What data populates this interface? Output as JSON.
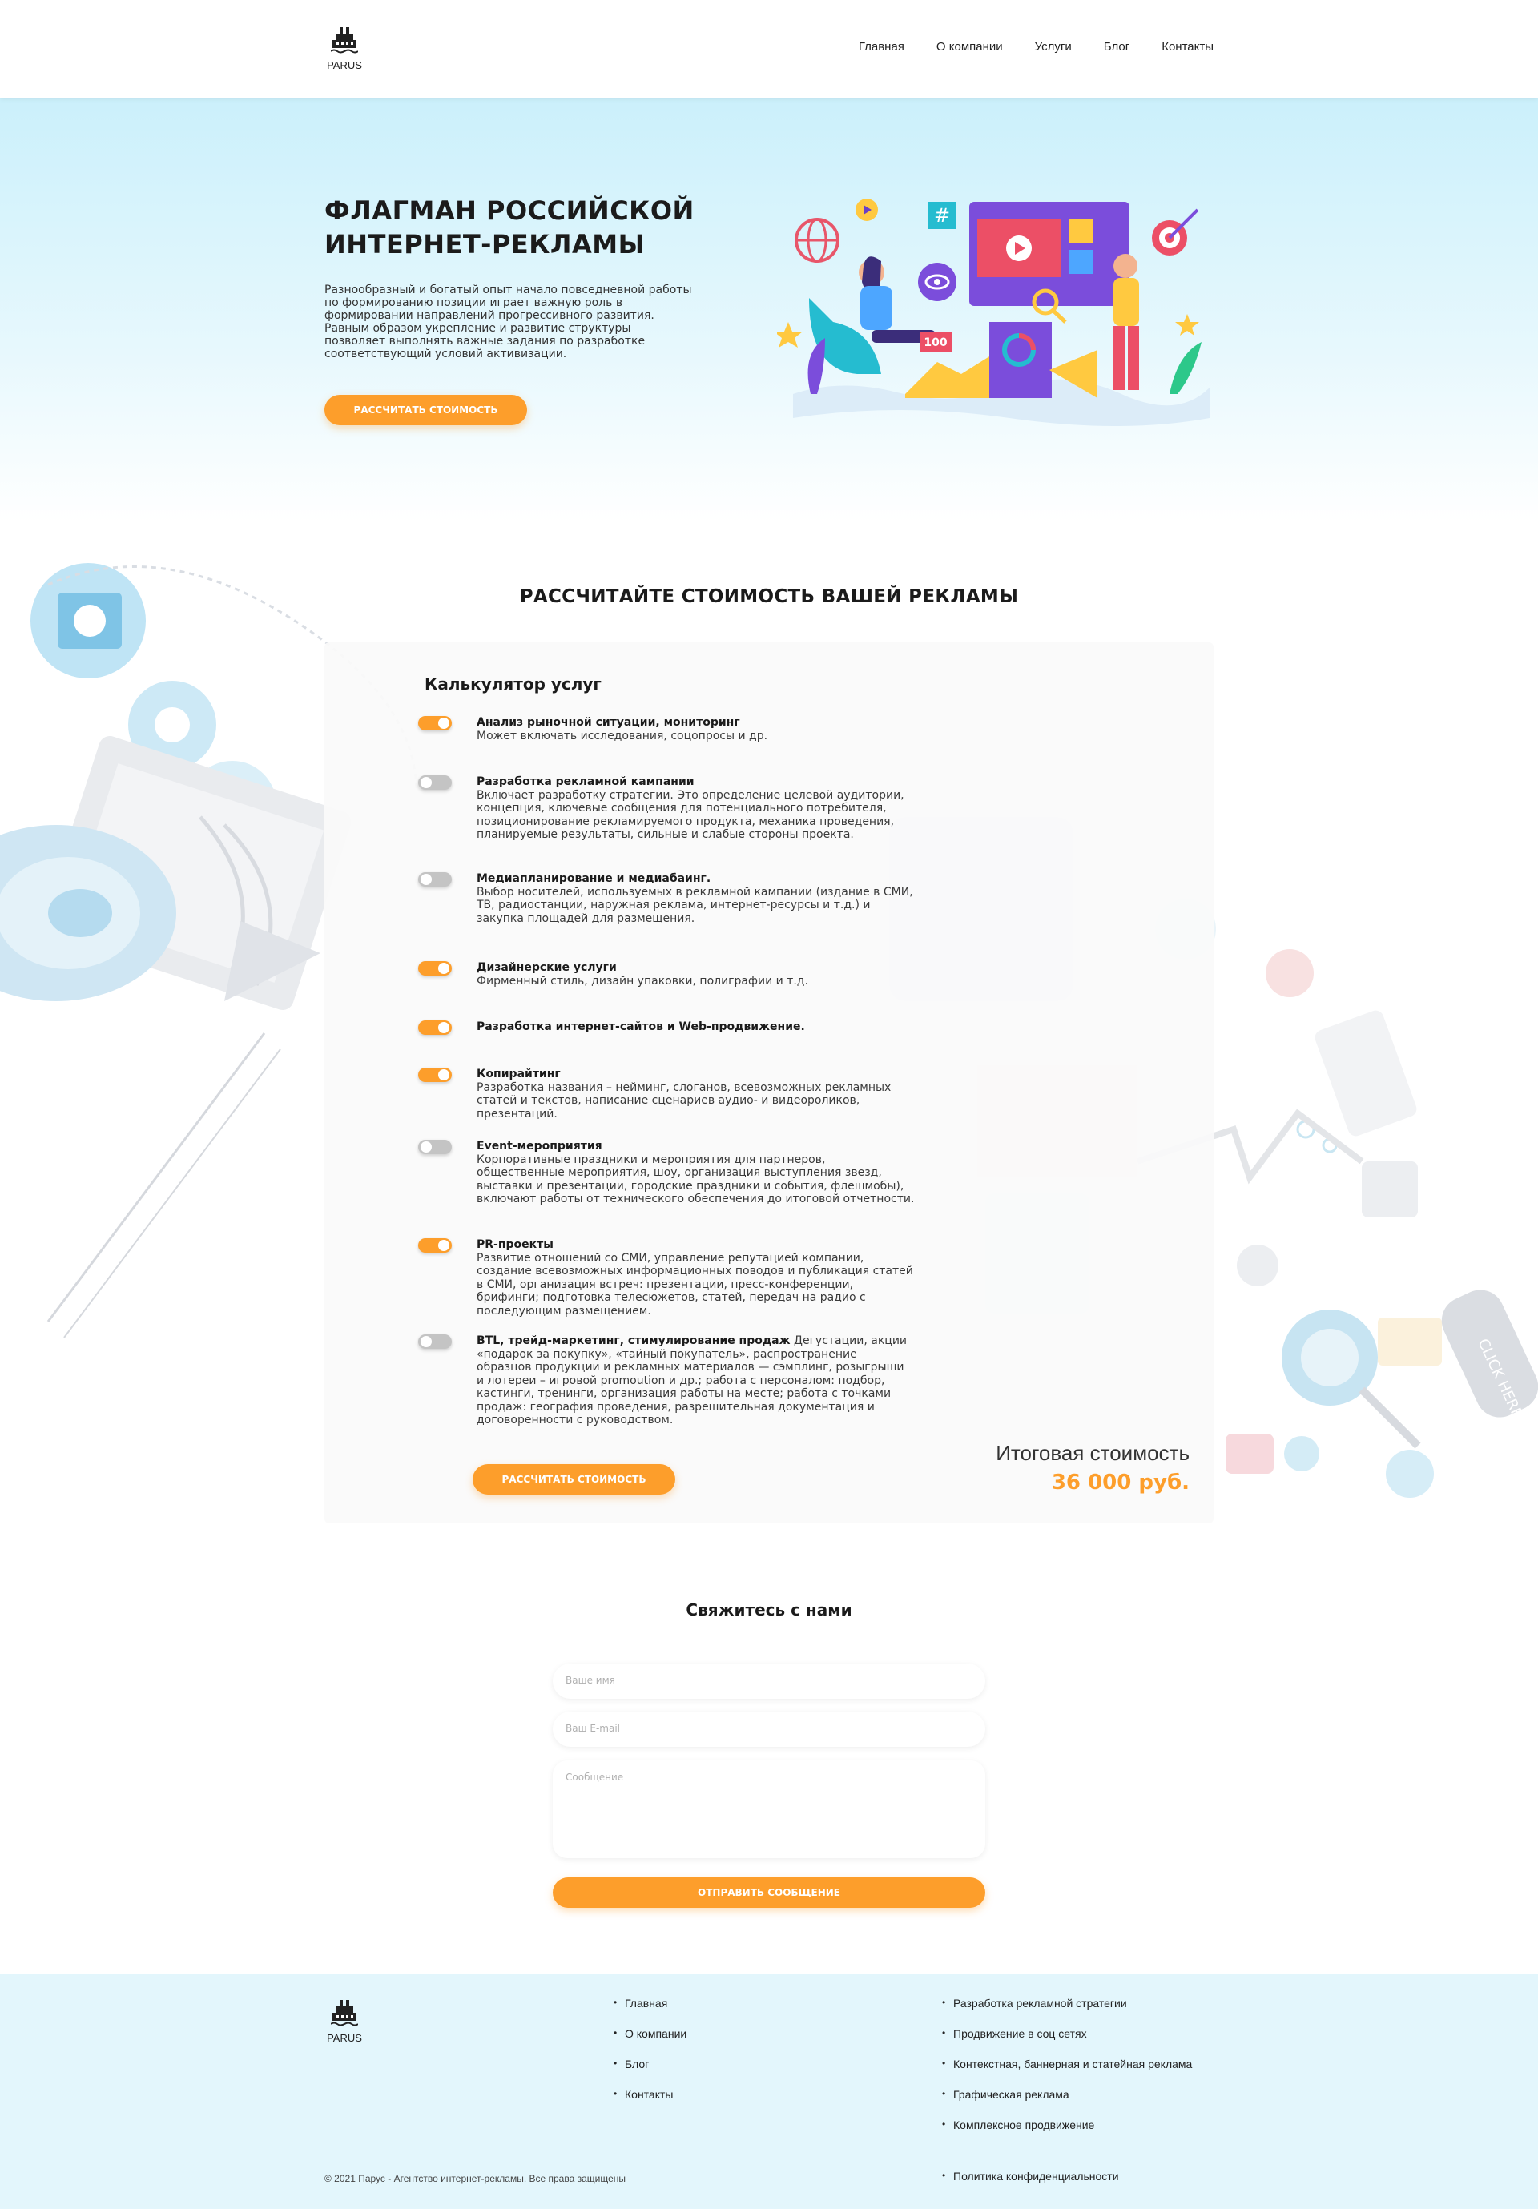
{
  "header": {
    "logo_text": "PARUS",
    "nav": [
      {
        "label": "Главная"
      },
      {
        "label": "О компании"
      },
      {
        "label": "Услуги"
      },
      {
        "label": "Блог"
      },
      {
        "label": "Контакты"
      }
    ]
  },
  "hero": {
    "title_line1": "ФЛАГМАН РОССИЙСКОЙ",
    "title_line2": "ИНТЕРНЕТ-РЕКЛАМЫ",
    "lead": "Разнообразный и богатый опыт начало повседневной работы по формированию позиции играет важную роль в формировании направлений прогрессивного развития. Равным образом укрепление и развитие структуры позволяет выполнять важные задания по разработке соответствующий условий активизации.",
    "button": "РАССЧИТАТЬ СТОИМОСТЬ",
    "art_badge": "100",
    "art_hash": "#"
  },
  "calculator": {
    "section_title": "РАССЧИТАЙТЕ СТОИМОСТЬ ВАШЕЙ РЕКЛАМЫ",
    "card_title": "Калькулятор услуг",
    "services": [
      {
        "name": "Анализ рыночной ситуации, мониторинг",
        "desc": "Может включать исследования, соцопросы и др.",
        "on": true,
        "inline": false
      },
      {
        "name": "Разработка рекламной кампании",
        "desc": "Включает разработку стратегии. Это определение целевой аудитории, концепция, ключевые сообщения для потенциального потребителя, позиционирование рекламируемого продукта, механика проведения, планируемые результаты, сильные и слабые стороны проекта.",
        "on": false,
        "inline": false
      },
      {
        "name": "Медиапланирование и медиабаинг.",
        "desc": "Выбор носителей, используемых в рекламной кампании (издание в СМИ, ТВ, радиостанции, наружная реклама, интернет-ресурсы и т.д.) и закупка площадей для размещения.",
        "on": false,
        "inline": false
      },
      {
        "name": "Дизайнерские услуги",
        "desc": "Фирменный стиль, дизайн упаковки, полиграфии и т.д.",
        "on": true,
        "inline": false
      },
      {
        "name": "Разработка интернет-сайтов и Web-продвижение.",
        "desc": "",
        "on": true,
        "inline": false
      },
      {
        "name": "Копирайтинг",
        "desc": "Разработка названия – нейминг, слоганов, всевозможных рекламных статей и текстов, написание сценариев аудио- и видеороликов, презентаций.",
        "on": true,
        "inline": false
      },
      {
        "name": "Event-мероприятия",
        "desc": "Корпоративные праздники и мероприятия для партнеров, общественные мероприятия, шоу, организация выступления звезд, выставки и презентации, городские праздники и события, флешмобы), включают работы от технического обеспечения до итоговой отчетности.",
        "on": false,
        "inline": false
      },
      {
        "name": "PR-проекты",
        "desc": "Развитие отношений со СМИ, управление репутацией компании, создание всевозможных информационных поводов и публикация статей в СМИ, организация встреч: презентации, пресс-конференции, брифинги; подготовка телесюжетов, статей, передач на радио с последующим размещением.",
        "on": true,
        "inline": false
      },
      {
        "name": "BTL, трейд-маркетинг, стимулирование продаж",
        "desc": "Дегустации, акции «подарок за покупку», «тайный покупатель», распространение образцов продукции и рекламных материалов — сэмплинг, розыгрыши и лотереи – игровой promoution и др.; работа с персоналом: подбор, кастинги, тренинги, организация работы на месте; работа с точками продаж: география проведения, разрешительная документация и договоренности с руководством.",
        "on": false,
        "inline": true
      }
    ],
    "total_label": "Итоговая стоимость",
    "total_value": "36 000 руб.",
    "button": "РАССЧИТАТЬ СТОИМОСТЬ",
    "bg_text": "CLICK HERE"
  },
  "contact": {
    "title": "Свяжитесь с нами",
    "name_placeholder": "Ваше имя",
    "email_placeholder": "Ваш E-mail",
    "message_placeholder": "Сообщение",
    "button": "ОТПРАВИТЬ СООБЩЕНИЕ"
  },
  "footer": {
    "logo_text": "PARUS",
    "nav": [
      {
        "label": "Главная"
      },
      {
        "label": "О компании"
      },
      {
        "label": "Блог"
      },
      {
        "label": "Контакты"
      }
    ],
    "services": [
      {
        "label": "Разработка рекламной стратегии"
      },
      {
        "label": "Продвижение в соц сетях"
      },
      {
        "label": "Контекстная, баннерная и статейная реклама"
      },
      {
        "label": "Графическая реклама"
      },
      {
        "label": "Комплексное продвижение"
      }
    ],
    "policy": "Политика конфиденциальности",
    "copyright": "© 2021 Парус - Агентство интернет-рекламы. Все права защищены"
  }
}
